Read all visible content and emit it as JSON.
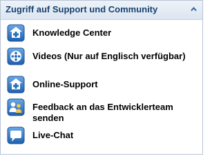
{
  "panel": {
    "title": "Zugriff auf Support und Community",
    "collapse_icon": "chevron-up-icon"
  },
  "items": [
    {
      "label": "Knowledge Center",
      "icon": "knowledge-center-icon"
    },
    {
      "label": "Videos (Nur auf Englisch verfügbar)",
      "icon": "film-reel-icon"
    },
    {
      "label": "Online-Support",
      "icon": "support-plus-icon"
    },
    {
      "label": "Feedback an das Entwicklerteam senden",
      "icon": "people-icon"
    },
    {
      "label": "Live-Chat",
      "icon": "chat-icon"
    }
  ],
  "colors": {
    "header_text": "#17406f",
    "icon_blue": "#1f6fbe",
    "border": "#b7c3d3"
  }
}
